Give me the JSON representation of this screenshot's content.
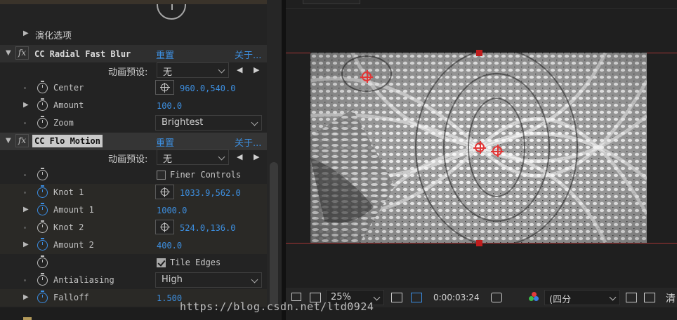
{
  "options_label": "演化选项",
  "effects": [
    {
      "name": "CC Radial Fast Blur",
      "reset": "重置",
      "about": "关于...",
      "preset_label": "动画预设:",
      "preset_value": "无",
      "params": [
        {
          "label": "Center",
          "value": "960.0,540.0"
        },
        {
          "label": "Amount",
          "value": "100.0"
        },
        {
          "label": "Zoom",
          "value": "Brightest"
        }
      ]
    },
    {
      "name": "CC Flo Motion",
      "reset": "重置",
      "about": "关于...",
      "preset_label": "动画预设:",
      "preset_value": "无",
      "params": [
        {
          "label": "",
          "value": "Finer Controls",
          "checked": false
        },
        {
          "label": "Knot 1",
          "value": "1033.9,562.0"
        },
        {
          "label": "Amount 1",
          "value": "1000.0"
        },
        {
          "label": "Knot 2",
          "value": "524.0,136.0"
        },
        {
          "label": "Amount 2",
          "value": "400.0"
        },
        {
          "label": "",
          "value": "Tile Edges",
          "checked": true
        },
        {
          "label": "Antialiasing",
          "value": "High"
        },
        {
          "label": "Falloff",
          "value": "1.500"
        }
      ]
    }
  ],
  "viewer": {
    "zoom": "25%",
    "timecode": "0:00:03:24",
    "view_select": "(四分",
    "cut_label": "清"
  },
  "watermark": "https://blog.csdn.net/ltd0924",
  "colors": {
    "link": "#3d8fe0",
    "guide": "#a33434",
    "handle": "#c01d1d"
  }
}
